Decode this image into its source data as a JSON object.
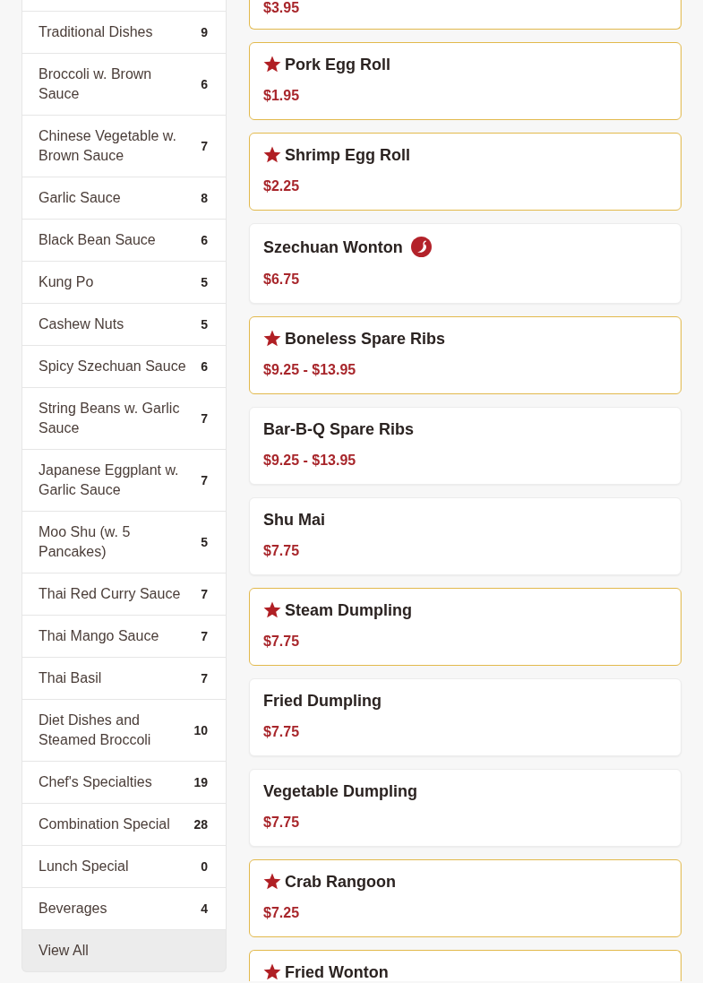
{
  "sidebar": {
    "items": [
      {
        "label": "Traditional Dishes",
        "count": "9",
        "selected": false
      },
      {
        "label": "Broccoli w. Brown Sauce",
        "count": "6",
        "selected": false
      },
      {
        "label": "Chinese Vegetable w. Brown Sauce",
        "count": "7",
        "selected": false
      },
      {
        "label": "Garlic Sauce",
        "count": "8",
        "selected": false
      },
      {
        "label": "Black Bean Sauce",
        "count": "6",
        "selected": false
      },
      {
        "label": "Kung Po",
        "count": "5",
        "selected": false
      },
      {
        "label": "Cashew Nuts",
        "count": "5",
        "selected": false
      },
      {
        "label": "Spicy Szechuan Sauce",
        "count": "6",
        "selected": false
      },
      {
        "label": "String Beans w. Garlic Sauce",
        "count": "7",
        "selected": false
      },
      {
        "label": "Japanese Eggplant w. Garlic Sauce",
        "count": "7",
        "selected": false
      },
      {
        "label": "Moo Shu (w. 5 Pancakes)",
        "count": "5",
        "selected": false
      },
      {
        "label": "Thai Red Curry Sauce",
        "count": "7",
        "selected": false
      },
      {
        "label": "Thai Mango Sauce",
        "count": "7",
        "selected": false
      },
      {
        "label": "Thai Basil",
        "count": "7",
        "selected": false
      },
      {
        "label": "Diet Dishes and Steamed Broccoli",
        "count": "10",
        "selected": false
      },
      {
        "label": "Chef's Specialties",
        "count": "19",
        "selected": false
      },
      {
        "label": "Combination Special",
        "count": "28",
        "selected": false
      },
      {
        "label": "Lunch Special",
        "count": "0",
        "selected": false
      },
      {
        "label": "Beverages",
        "count": "4",
        "selected": false
      },
      {
        "label": "View All",
        "selected": true
      }
    ]
  },
  "menu_items": [
    {
      "price": "$3.95",
      "featured": true
    },
    {
      "name": "Pork Egg Roll",
      "price": "$1.95",
      "featured": true,
      "spicy": false
    },
    {
      "name": "Shrimp Egg Roll",
      "price": "$2.25",
      "featured": true,
      "spicy": false
    },
    {
      "name": "Szechuan Wonton",
      "price": "$6.75",
      "featured": false,
      "spicy": true
    },
    {
      "name": "Boneless Spare Ribs",
      "price": "$9.25 - $13.95",
      "featured": true,
      "spicy": false
    },
    {
      "name": "Bar-B-Q Spare Ribs",
      "price": "$9.25 - $13.95",
      "featured": false,
      "spicy": false
    },
    {
      "name": "Shu Mai",
      "price": "$7.75",
      "featured": false,
      "spicy": false
    },
    {
      "name": "Steam Dumpling",
      "price": "$7.75",
      "featured": true,
      "spicy": false
    },
    {
      "name": "Fried Dumpling",
      "price": "$7.75",
      "featured": false,
      "spicy": false
    },
    {
      "name": "Vegetable Dumpling",
      "price": "$7.75",
      "featured": false,
      "spicy": false
    },
    {
      "name": "Crab Rangoon",
      "price": "$7.25",
      "featured": true,
      "spicy": false
    },
    {
      "name": "Fried Wonton",
      "featured": true,
      "spicy": false
    }
  ]
}
